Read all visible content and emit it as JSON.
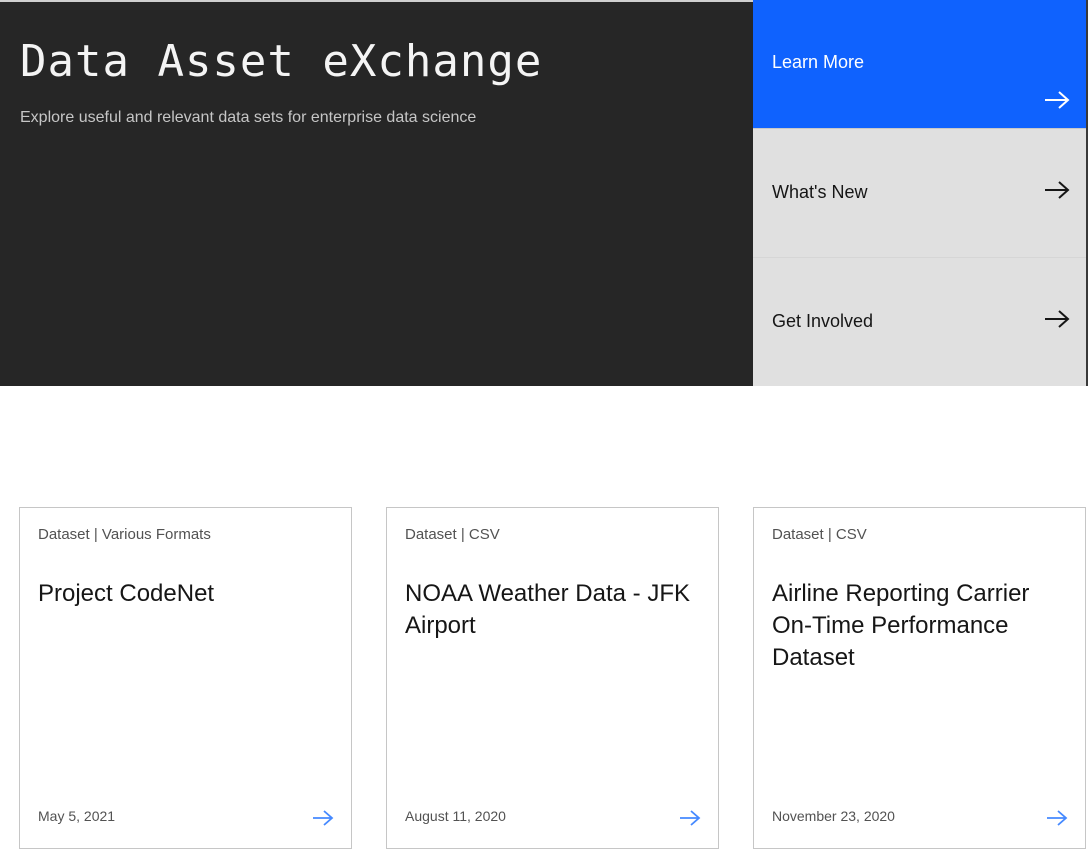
{
  "hero": {
    "title": "Data Asset eXchange",
    "subtitle": "Explore useful and relevant data sets for enterprise data science"
  },
  "side_links": [
    {
      "label": "Learn More",
      "icon": "arrow-right-icon"
    },
    {
      "label": "What's New",
      "icon": "arrow-right-icon"
    },
    {
      "label": "Get Involved",
      "icon": "arrow-right-icon"
    }
  ],
  "cards": [
    {
      "meta": "Dataset | Various Formats",
      "title": "Project CodeNet",
      "date": "May 5, 2021",
      "icon": "arrow-right-icon"
    },
    {
      "meta": "Dataset | CSV",
      "title": "NOAA Weather Data - JFK Airport",
      "date": "August 11, 2020",
      "icon": "arrow-right-icon"
    },
    {
      "meta": "Dataset | CSV",
      "title": "Airline Reporting Carrier On-Time Performance Dataset",
      "date": "November 23, 2020",
      "icon": "arrow-right-icon"
    }
  ],
  "colors": {
    "hero_bg": "#262626",
    "primary_link_bg": "#0f62fe",
    "secondary_link_bg": "#e0e0e0",
    "card_arrow": "#4589ff"
  }
}
